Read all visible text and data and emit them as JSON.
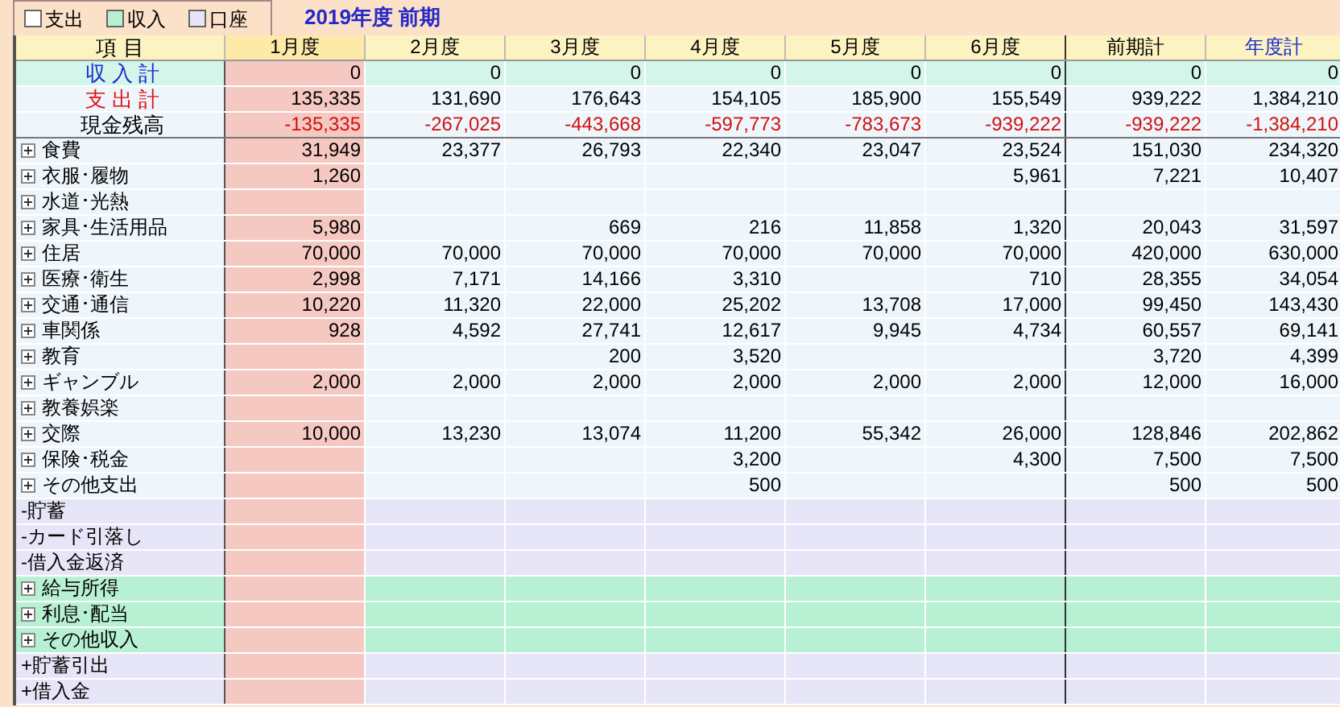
{
  "legend": [
    {
      "label": "支出",
      "color": "#ffffff"
    },
    {
      "label": "収入",
      "color": "#b8f0d4"
    },
    {
      "label": "口座",
      "color": "#e6e6f8"
    }
  ],
  "title": "2019年度 前期",
  "columns": [
    {
      "label": "項 目",
      "selected": false,
      "accent": false
    },
    {
      "label": "1月度",
      "selected": true,
      "accent": false
    },
    {
      "label": "2月度",
      "selected": false,
      "accent": false
    },
    {
      "label": "3月度",
      "selected": false,
      "accent": false
    },
    {
      "label": "4月度",
      "selected": false,
      "accent": false
    },
    {
      "label": "5月度",
      "selected": false,
      "accent": false
    },
    {
      "label": "6月度",
      "selected": false,
      "accent": false
    },
    {
      "label": "前期計",
      "selected": false,
      "accent": false
    },
    {
      "label": "年度計",
      "selected": false,
      "accent": true
    }
  ],
  "rows": [
    {
      "kind": "income_total",
      "label": "収 入 計",
      "values": {
        "m1": "0",
        "m2": "0",
        "m3": "0",
        "m4": "0",
        "m5": "0",
        "m6": "0",
        "half": "0",
        "year": "0"
      }
    },
    {
      "kind": "expense_total",
      "label": "支 出 計",
      "values": {
        "m1": "135,335",
        "m2": "131,690",
        "m3": "176,643",
        "m4": "154,105",
        "m5": "185,900",
        "m6": "155,549",
        "half": "939,222",
        "year": "1,384,210"
      }
    },
    {
      "kind": "balance",
      "label": "現金残高",
      "values": {
        "m1": "-135,335",
        "m2": "-267,025",
        "m3": "-443,668",
        "m4": "-597,773",
        "m5": "-783,673",
        "m6": "-939,222",
        "half": "-939,222",
        "year": "-1,384,210"
      }
    },
    {
      "kind": "expense",
      "label": "食費",
      "values": {
        "m1": "31,949",
        "m2": "23,377",
        "m3": "26,793",
        "m4": "22,340",
        "m5": "23,047",
        "m6": "23,524",
        "half": "151,030",
        "year": "234,320"
      }
    },
    {
      "kind": "expense",
      "label": "衣服･履物",
      "values": {
        "m1": "1,260",
        "m6": "5,961",
        "half": "7,221",
        "year": "10,407"
      }
    },
    {
      "kind": "expense",
      "label": "水道･光熱"
    },
    {
      "kind": "expense",
      "label": "家具･生活用品",
      "values": {
        "m1": "5,980",
        "m3": "669",
        "m4": "216",
        "m5": "11,858",
        "m6": "1,320",
        "half": "20,043",
        "year": "31,597"
      }
    },
    {
      "kind": "expense",
      "label": "住居",
      "values": {
        "m1": "70,000",
        "m2": "70,000",
        "m3": "70,000",
        "m4": "70,000",
        "m5": "70,000",
        "m6": "70,000",
        "half": "420,000",
        "year": "630,000"
      }
    },
    {
      "kind": "expense",
      "label": "医療･衛生",
      "values": {
        "m1": "2,998",
        "m2": "7,171",
        "m3": "14,166",
        "m4": "3,310",
        "m6": "710",
        "half": "28,355",
        "year": "34,054"
      }
    },
    {
      "kind": "expense",
      "label": "交通･通信",
      "values": {
        "m1": "10,220",
        "m2": "11,320",
        "m3": "22,000",
        "m4": "25,202",
        "m5": "13,708",
        "m6": "17,000",
        "half": "99,450",
        "year": "143,430"
      }
    },
    {
      "kind": "expense",
      "label": "車関係",
      "values": {
        "m1": "928",
        "m2": "4,592",
        "m3": "27,741",
        "m4": "12,617",
        "m5": "9,945",
        "m6": "4,734",
        "half": "60,557",
        "year": "69,141"
      }
    },
    {
      "kind": "expense",
      "label": "教育",
      "values": {
        "m3": "200",
        "m4": "3,520",
        "half": "3,720",
        "year": "4,399"
      }
    },
    {
      "kind": "expense",
      "label": "ギャンブル",
      "values": {
        "m1": "2,000",
        "m2": "2,000",
        "m3": "2,000",
        "m4": "2,000",
        "m5": "2,000",
        "m6": "2,000",
        "half": "12,000",
        "year": "16,000"
      }
    },
    {
      "kind": "expense",
      "label": "教養娯楽"
    },
    {
      "kind": "expense",
      "label": "交際",
      "values": {
        "m1": "10,000",
        "m2": "13,230",
        "m3": "13,074",
        "m4": "11,200",
        "m5": "55,342",
        "m6": "26,000",
        "half": "128,846",
        "year": "202,862"
      }
    },
    {
      "kind": "expense",
      "label": "保険･税金",
      "values": {
        "m4": "3,200",
        "m6": "4,300",
        "half": "7,500",
        "year": "7,500"
      }
    },
    {
      "kind": "expense",
      "label": "その他支出",
      "values": {
        "m4": "500",
        "half": "500",
        "year": "500"
      }
    },
    {
      "kind": "account",
      "label": "-貯蓄"
    },
    {
      "kind": "account",
      "label": "-カード引落し"
    },
    {
      "kind": "account",
      "label": "-借入金返済"
    },
    {
      "kind": "income",
      "label": "給与所得"
    },
    {
      "kind": "income",
      "label": "利息･配当"
    },
    {
      "kind": "income",
      "label": "その他収入"
    },
    {
      "kind": "account",
      "label": "+貯蓄引出"
    },
    {
      "kind": "account",
      "label": "+借入金"
    }
  ]
}
